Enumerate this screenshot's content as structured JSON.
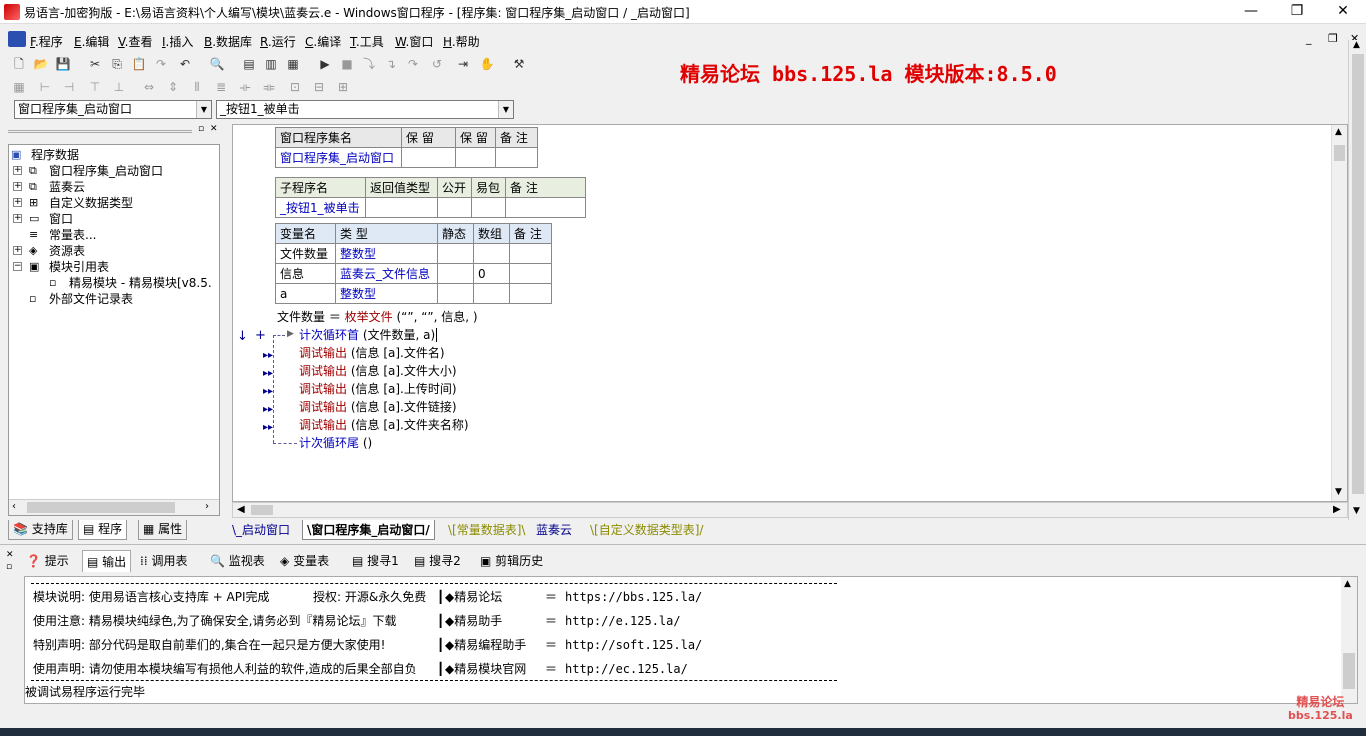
{
  "window": {
    "title": "易语言-加密狗版 - E:\\易语言资料\\个人编写\\模块\\蓝奏云.e - Windows窗口程序 - [程序集: 窗口程序集_启动窗口 / _启动窗口]",
    "minimize": "—",
    "restore": "❐",
    "close": "✕"
  },
  "menu": {
    "items": [
      {
        "key": "F",
        "label": ".程序"
      },
      {
        "key": "E",
        "label": ".编辑"
      },
      {
        "key": "V",
        "label": ".查看"
      },
      {
        "key": "I",
        "label": ".插入"
      },
      {
        "key": "B",
        "label": ".数据库"
      },
      {
        "key": "R",
        "label": ".运行"
      },
      {
        "key": "C",
        "label": ".编译"
      },
      {
        "key": "T",
        "label": ".工具"
      },
      {
        "key": "W",
        "label": ".窗口"
      },
      {
        "key": "H",
        "label": ".帮助"
      }
    ]
  },
  "banner": {
    "text": "精易论坛 bbs.125.la 模块版本:8.5.0",
    "color": "#e00000"
  },
  "combos": {
    "left": "窗口程序集_启动窗口",
    "right": "_按钮1_被单击"
  },
  "tree": {
    "root": "程序数据",
    "items": [
      {
        "label": "窗口程序集_启动窗口",
        "icon": "assembly-icon",
        "glyph": "⧉",
        "exp": "+"
      },
      {
        "label": "蓝奏云",
        "icon": "assembly-icon",
        "glyph": "⧉",
        "exp": "+"
      },
      {
        "label": "自定义数据类型",
        "icon": "datatype-icon",
        "glyph": "⊞",
        "exp": "+"
      },
      {
        "label": "窗口",
        "icon": "window-icon",
        "glyph": "▭",
        "exp": "+"
      },
      {
        "label": "常量表...",
        "icon": "constant-icon",
        "glyph": "≡",
        "exp": ""
      },
      {
        "label": "资源表",
        "icon": "resource-icon",
        "glyph": "◈",
        "exp": "+"
      },
      {
        "label": "模块引用表",
        "icon": "module-ref-icon",
        "glyph": "▣",
        "exp": "−"
      },
      {
        "label": "精易模块 - 精易模块[v8.5.",
        "icon": "module-icon",
        "glyph": "▫",
        "exp": "",
        "indent": true
      },
      {
        "label": "外部文件记录表",
        "icon": "file-record-icon",
        "glyph": "▫",
        "exp": ""
      }
    ]
  },
  "left_tabs": [
    "支持库",
    "程序",
    "属性"
  ],
  "assembly_table": {
    "headers": [
      "窗口程序集名",
      "保 留",
      "保 留",
      "备 注"
    ],
    "row": [
      "窗口程序集_启动窗口",
      "",
      "",
      ""
    ]
  },
  "sub_table": {
    "headers": [
      "子程序名",
      "返回值类型",
      "公开",
      "易包",
      "备 注"
    ],
    "row": [
      "_按钮1_被单击",
      "",
      "",
      "",
      ""
    ]
  },
  "var_table": {
    "headers": [
      "变量名",
      "类 型",
      "静态",
      "数组",
      "备 注"
    ],
    "rows": [
      [
        "文件数量",
        "整数型",
        "",
        "",
        ""
      ],
      [
        "信息",
        "蓝奏云_文件信息",
        "",
        "0",
        ""
      ],
      [
        "a",
        "整数型",
        "",
        "",
        ""
      ]
    ]
  },
  "code": {
    "line0": {
      "a": "文件数量 ＝ ",
      "b": "枚举文件",
      "c": " (“”, “”, 信息, )"
    },
    "loop_head": {
      "a": "计次循环首",
      "b": " (文件数量, a)"
    },
    "debug_lines": [
      {
        "fn": "调试输出",
        "args": " (信息 [a].文件名)"
      },
      {
        "fn": "调试输出",
        "args": " (信息 [a].文件大小)"
      },
      {
        "fn": "调试输出",
        "args": " (信息 [a].上传时间)"
      },
      {
        "fn": "调试输出",
        "args": " (信息 [a].文件链接)"
      },
      {
        "fn": "调试输出",
        "args": " (信息 [a].文件夹名称)"
      }
    ],
    "loop_tail": {
      "a": "计次循环尾",
      "b": " ()"
    }
  },
  "doc_tabs": [
    "_启动窗口",
    "窗口程序集_启动窗口",
    "[常量数据表]",
    "蓝奏云",
    "[自定义数据类型表]"
  ],
  "bottom_tabs": [
    "提示",
    "输出",
    "调用表",
    "监视表",
    "变量表",
    "搜寻1",
    "搜寻2",
    "剪辑历史"
  ],
  "output": {
    "rows": [
      {
        "a": "模块说明: 使用易语言核心支持库 + API完成",
        "b": "授权: 开源&永久免费",
        "c": "◆精易论坛",
        "d": "https://bbs.125.la/"
      },
      {
        "a": "使用注意: 精易模块纯绿色,为了确保安全,请务必到『精易论坛』下载",
        "b": "",
        "c": "◆精易助手",
        "d": "http://e.125.la/"
      },
      {
        "a": "特别声明: 部分代码是取自前辈们的,集合在一起只是方便大家使用!",
        "b": "",
        "c": "◆精易编程助手",
        "d": "http://soft.125.la/"
      },
      {
        "a": "使用声明: 请勿使用本模块编写有损他人利益的软件,造成的后果全部自负",
        "b": "",
        "c": "◆精易模块官网",
        "d": "http://ec.125.la/"
      }
    ],
    "status": "被调试易程序运行完毕"
  },
  "watermark": {
    "line1": "精易论坛",
    "line2": "bbs.125.la"
  }
}
